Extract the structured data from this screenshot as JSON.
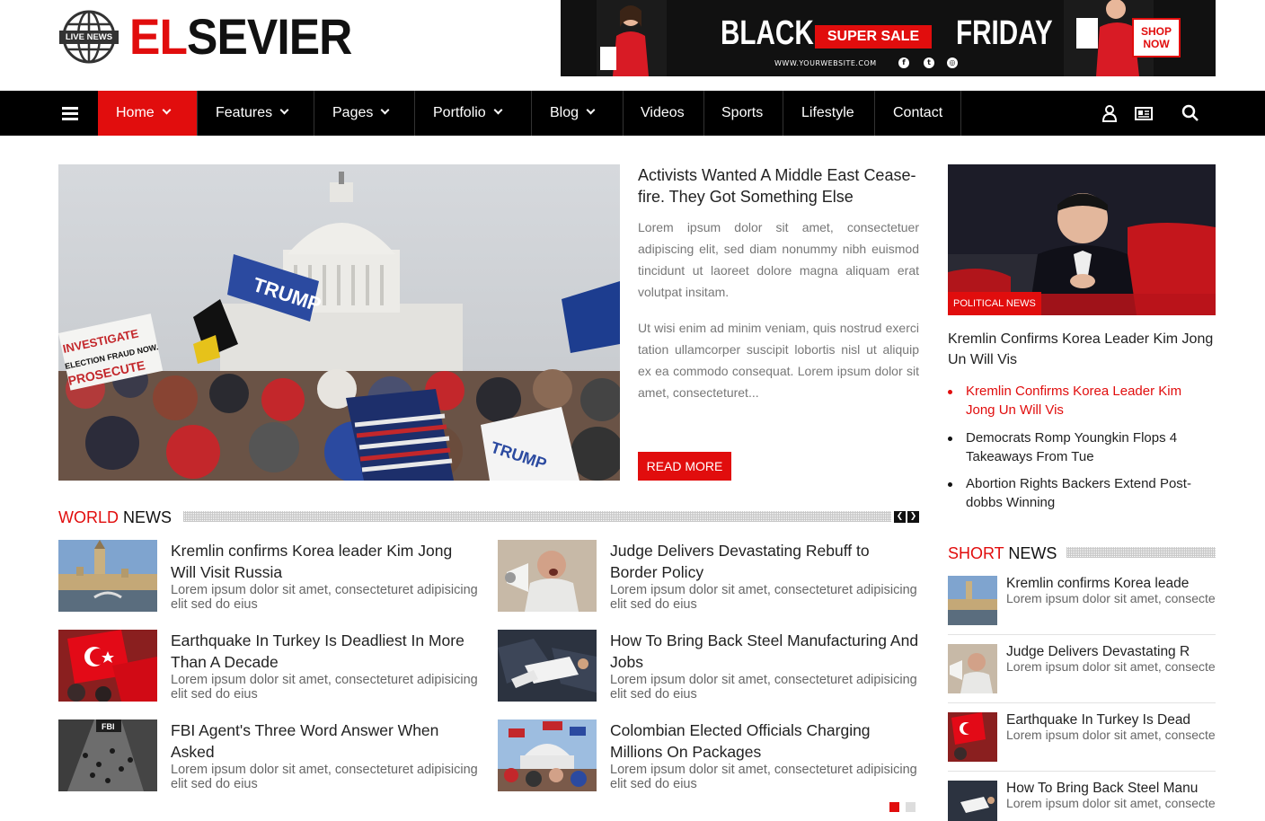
{
  "brand": {
    "badge": "LIVE NEWS",
    "logo_red": "EL",
    "logo_dark": "SEVIER",
    "accent": "#e10d0d"
  },
  "banner": {
    "left_word": "BLACK",
    "center_word": "SUPER SALE",
    "right_word": "FRIDAY",
    "url": "WWW.YOURWEBSITE.COM",
    "social_icons": [
      "facebook-icon",
      "twitter-icon",
      "instagram-icon"
    ],
    "cta_line1": "SHOP",
    "cta_line2": "NOW"
  },
  "nav": {
    "items": [
      {
        "label": "Home",
        "dropdown": true,
        "active": true
      },
      {
        "label": "Features",
        "dropdown": true
      },
      {
        "label": "Pages",
        "dropdown": true
      },
      {
        "label": "Portfolio",
        "dropdown": true
      },
      {
        "label": "Blog",
        "dropdown": true
      },
      {
        "label": "Videos"
      },
      {
        "label": "Sports"
      },
      {
        "label": "Lifestyle"
      },
      {
        "label": "Contact"
      }
    ],
    "right_icons": [
      "user-icon",
      "id-card-icon",
      "search-icon"
    ]
  },
  "featured": {
    "title": "Activists Wanted A Middle East Cease-fire. They Got Something Else",
    "para1": "Lorem ipsum dolor sit amet, consectetuer adipiscing elit, sed diam nonummy nibh euismod tincidunt ut laoreet dolore magna aliquam erat volutpat insitam.",
    "para2": "Ut wisi enim ad minim veniam, quis nostrud exerci tation ullamcorper suscipit lobortis nisl ut aliquip ex ea commodo consequat. Lorem ipsum dolor sit amet, consecteturet...",
    "button": "READ MORE"
  },
  "world_news": {
    "heading_red": "WORLD",
    "heading_dark": "NEWS",
    "items": [
      {
        "title": "Kremlin confirms Korea leader Kim Jong Will Visit Russia",
        "desc": "Lorem ipsum dolor sit amet, consecteturet adipisicing elit sed do eius"
      },
      {
        "title": "Judge Delivers Devastating Rebuff to Border Policy",
        "desc": "Lorem ipsum dolor sit amet, consecteturet adipisicing elit sed do eius"
      },
      {
        "title": "Earthquake In Turkey Is Deadliest In More Than A Decade",
        "desc": "Lorem ipsum dolor sit amet, consecteturet adipisicing elit sed do eius"
      },
      {
        "title": "How To Bring Back Steel Manufacturing And Jobs",
        "desc": "Lorem ipsum dolor sit amet, consecteturet adipisicing elit sed do eius"
      },
      {
        "title": "FBI Agent's Three Word Answer When Asked",
        "desc": "Lorem ipsum dolor sit amet, consecteturet adipisicing elit sed do eius"
      },
      {
        "title": "Colombian Elected Officials Charging Millions On Packages",
        "desc": "Lorem ipsum dolor sit amet, consecteturet adipisicing elit sed do eius"
      }
    ]
  },
  "sidebar": {
    "tag": "POLITICAL NEWS",
    "title": "Kremlin Confirms Korea Leader Kim Jong Un Will Vis",
    "list": [
      {
        "label": "Kremlin Confirms Korea Leader Kim Jong Un Will Vis",
        "active": true
      },
      {
        "label": "Democrats Romp Youngkin Flops 4 Takeaways From Tue"
      },
      {
        "label": "Abortion Rights Backers Extend Post-dobbs Winning"
      }
    ]
  },
  "short_news": {
    "heading_red": "SHORT",
    "heading_dark": "NEWS",
    "items": [
      {
        "title": "Kremlin confirms Korea leade",
        "desc": "Lorem ipsum dolor sit amet, consecteturet adipisicing elit s"
      },
      {
        "title": "Judge Delivers Devastating R",
        "desc": "Lorem ipsum dolor sit amet, consecteturet adipisicing elit s"
      },
      {
        "title": "Earthquake In Turkey Is Dead",
        "desc": "Lorem ipsum dolor sit amet, consecteturet adipisicing elit s"
      },
      {
        "title": "How To Bring Back Steel Manu",
        "desc": "Lorem ipsum dolor sit amet, consecteturet adipisicing elit s"
      }
    ]
  }
}
